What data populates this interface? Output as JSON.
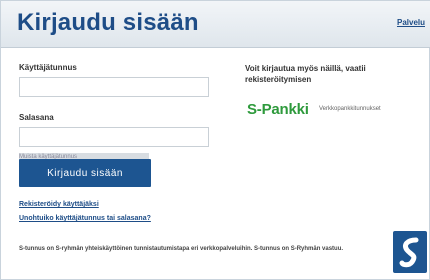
{
  "header": {
    "title": "Kirjaudu sisään",
    "link": "Palvelu"
  },
  "form": {
    "username_label": "Käyttäjätunnus",
    "username_value": "",
    "password_label": "Salasana",
    "password_value": "",
    "remember_label": "Muista käyttäjätunnus",
    "login_button": "Kirjaudu sisään"
  },
  "links": {
    "register": "Rekisteröidy käyttäjäksi",
    "forgot": "Unohtuiko käyttäjätunnus tai salasana?"
  },
  "alternative": {
    "text": "Voit kirjautua myös näillä, vaatii rekisteröitymisen",
    "provider_name": "S-Pankki",
    "provider_sub": "Verkkopankkitunnukset"
  },
  "footer": {
    "note": "S-tunnus on S-ryhmän yhteiskäyttöinen tunnistautumistapa eri verkkopalveluihin. S-tunnus on S-Ryhmän vastuu."
  },
  "colors": {
    "brand_blue": "#1d5591",
    "spankki_green": "#2e9a3c"
  },
  "icons": {
    "brand_logo": "s-group-logo-icon"
  }
}
